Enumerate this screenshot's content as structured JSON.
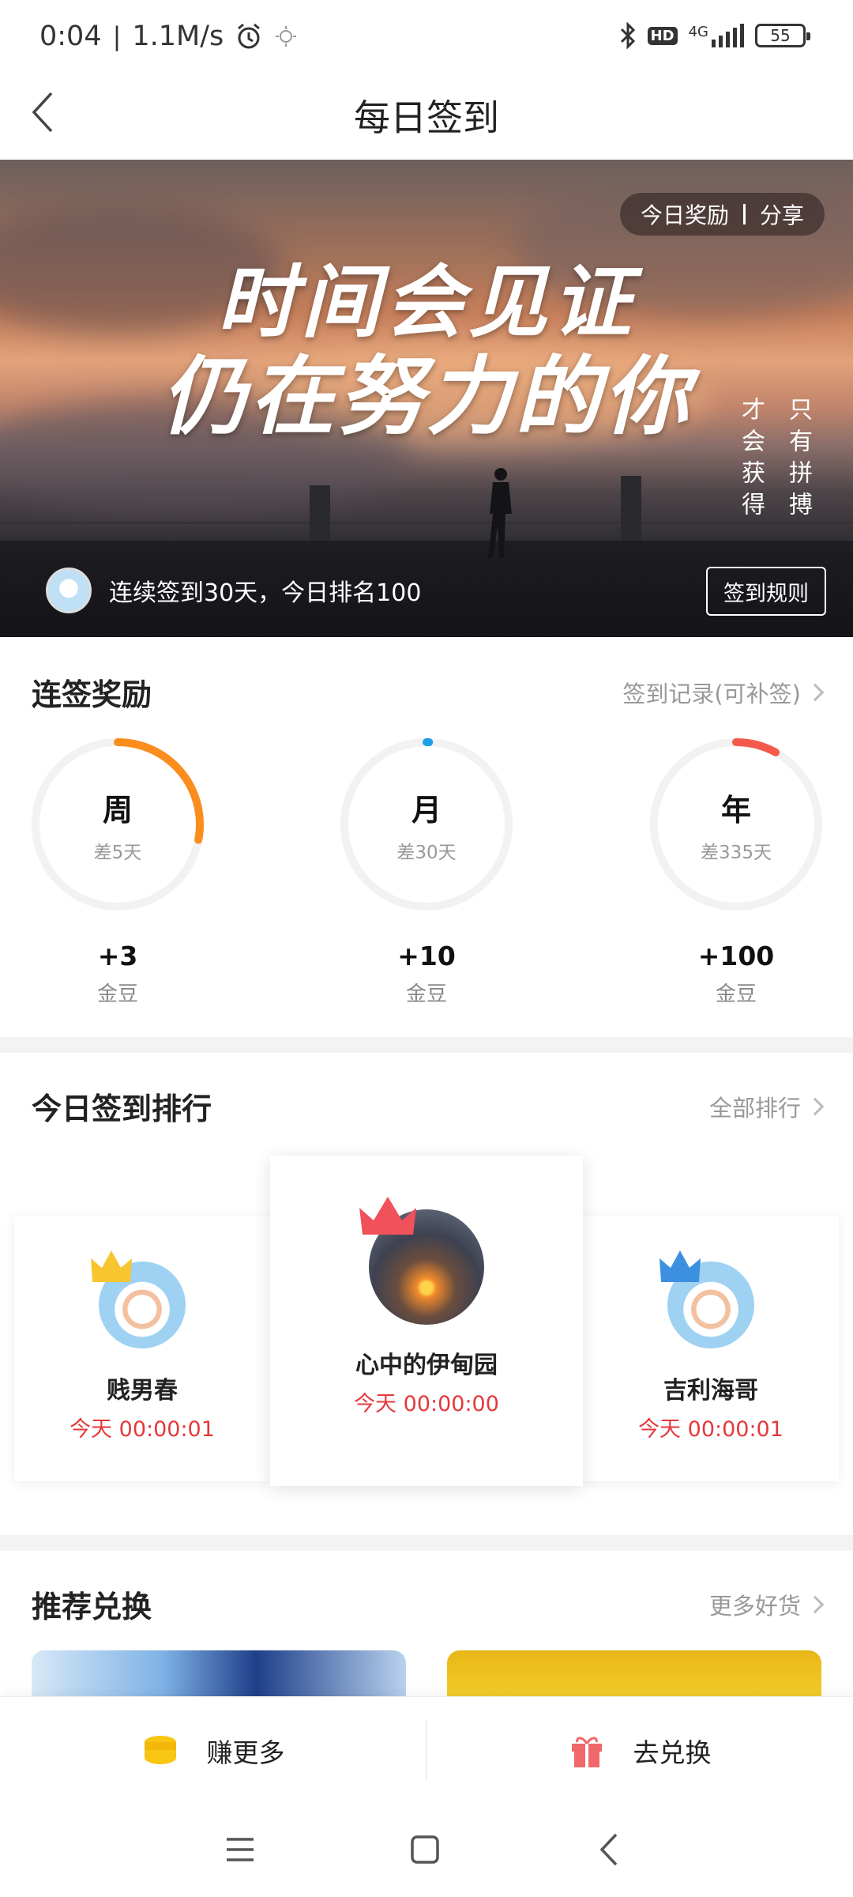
{
  "status_bar": {
    "time": "0:04",
    "speed": "1.1M/s",
    "network": "4G",
    "hd": "HD",
    "battery": "55"
  },
  "header": {
    "title": "每日签到"
  },
  "banner": {
    "slogan_line1": "时间会见证",
    "slogan_line2": "仍在努力的你",
    "vertical_col_right": "只有拼搏",
    "vertical_col_left": "才会获得",
    "today_reward": "今日奖励",
    "share": "分享",
    "streak_text": "连续签到30天，今日排名100",
    "rules_button": "签到规则"
  },
  "streak_rewards": {
    "title": "连签奖励",
    "link": "签到记录(可补签)",
    "items": [
      {
        "period": "周",
        "remaining": "差5天",
        "points": "+3",
        "unit": "金豆",
        "progress": 0.28,
        "color": "#fb8c1e"
      },
      {
        "period": "月",
        "remaining": "差30天",
        "points": "+10",
        "unit": "金豆",
        "progress": 0.0,
        "color": "#1fa0e6"
      },
      {
        "period": "年",
        "remaining": "差335天",
        "points": "+100",
        "unit": "金豆",
        "progress": 0.08,
        "color": "#f4594c"
      }
    ]
  },
  "ranking": {
    "title": "今日签到排行",
    "link": "全部排行",
    "entries": [
      {
        "name": "贱男春",
        "time": "今天 00:00:01"
      },
      {
        "name": "心中的伊甸园",
        "time": "今天 00:00:00"
      },
      {
        "name": "吉利海哥",
        "time": "今天 00:00:01"
      }
    ]
  },
  "exchange": {
    "title": "推荐兑换",
    "link": "更多好货"
  },
  "bottom_tabs": {
    "earn": "赚更多",
    "redeem": "去兑换"
  }
}
